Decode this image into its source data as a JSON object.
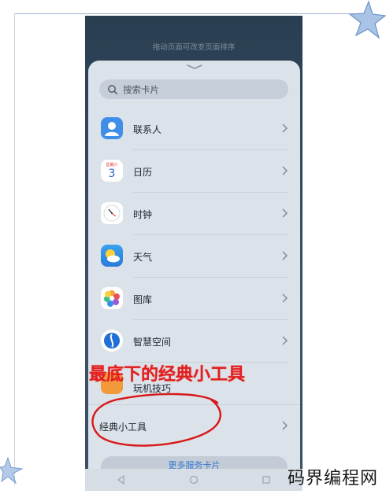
{
  "header_hint": "拖动页面可改变页面排序",
  "search": {
    "placeholder": "搜索卡片"
  },
  "items": [
    {
      "label": "联系人",
      "icon": "contacts-icon"
    },
    {
      "label": "日历",
      "icon": "calendar-icon",
      "calendar_day": "3",
      "calendar_header": "星期六"
    },
    {
      "label": "时钟",
      "icon": "clock-icon"
    },
    {
      "label": "天气",
      "icon": "weather-icon"
    },
    {
      "label": "图库",
      "icon": "gallery-icon"
    },
    {
      "label": "智慧空间",
      "icon": "smart-space-icon"
    },
    {
      "label": "玩机技巧",
      "icon": "tips-icon"
    },
    {
      "label": "经典小工具",
      "icon": ""
    }
  ],
  "more_button": "更多服务卡片",
  "annotation": "最底下的经典小工具",
  "watermark": "码界编程网",
  "colors": {
    "annotation": "#e02020",
    "accent": "#3878d0",
    "sheet_bg": "#dbe2ea"
  }
}
